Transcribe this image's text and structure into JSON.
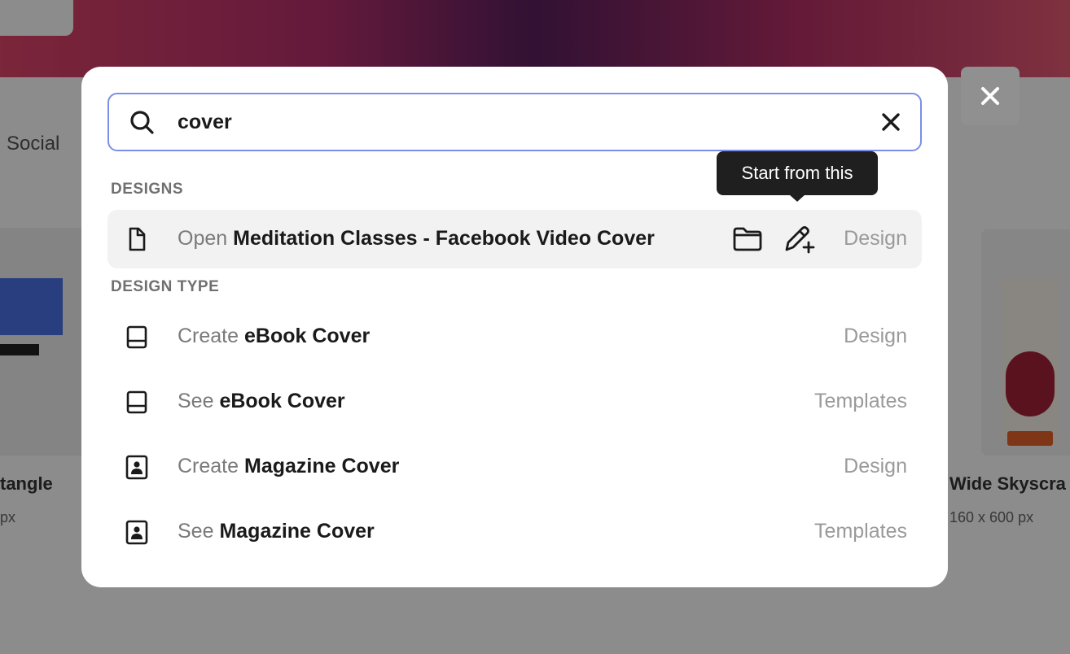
{
  "background": {
    "social_label": "Social",
    "left_card_label": "tangle",
    "left_card_sub": "px",
    "right_card_label": "Wide Skyscra",
    "right_card_sub": "160 x 600 px"
  },
  "search": {
    "value": "cover",
    "placeholder": ""
  },
  "tooltip": {
    "text": "Start from this"
  },
  "sections": {
    "designs": "DESIGNS",
    "design_type": "DESIGN TYPE"
  },
  "designs": [
    {
      "verb": "Open",
      "name": "Meditation Classes - Facebook Video Cover",
      "kind": "Design",
      "icon": "document-icon"
    }
  ],
  "design_types": [
    {
      "verb": "Create",
      "name": "eBook Cover",
      "kind": "Design",
      "icon": "book-icon"
    },
    {
      "verb": "See",
      "name": "eBook Cover",
      "kind": "Templates",
      "icon": "book-icon"
    },
    {
      "verb": "Create",
      "name": "Magazine Cover",
      "kind": "Design",
      "icon": "magazine-icon"
    },
    {
      "verb": "See",
      "name": "Magazine Cover",
      "kind": "Templates",
      "icon": "magazine-icon"
    }
  ],
  "colors": {
    "search_border": "#7b8ee8",
    "highlight_row": "#f2f2f2",
    "tooltip_bg": "#1f1f1f"
  }
}
